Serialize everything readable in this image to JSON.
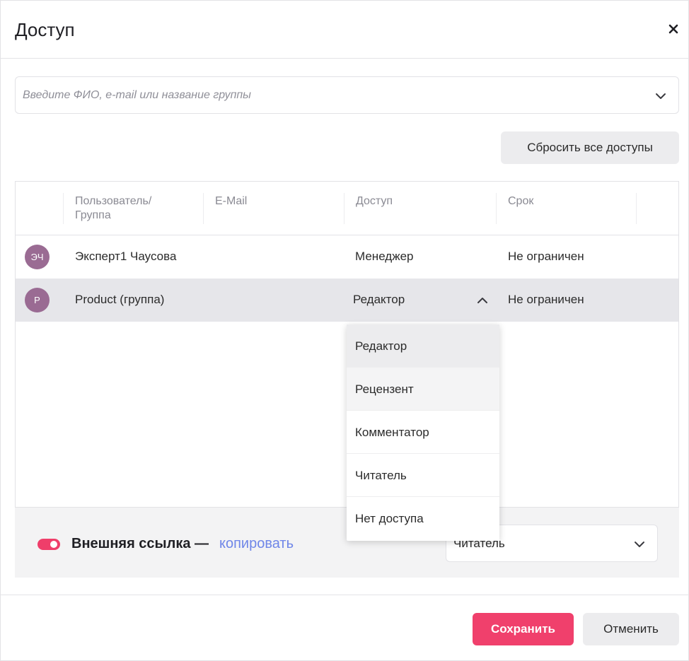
{
  "dialog": {
    "title": "Доступ",
    "close_icon": "close-icon"
  },
  "search": {
    "placeholder": "Введите ФИО, e-mail или название группы",
    "value": ""
  },
  "reset_button_label": "Сбросить все доступы",
  "table": {
    "columns": [
      "Пользователь/ Группа",
      "E-Mail",
      "Доступ",
      "Срок"
    ],
    "rows": [
      {
        "initials": "ЭЧ",
        "name": "Эксперт1 Чаусова",
        "email": "",
        "access": "Менеджер",
        "term": "Не ограничен"
      },
      {
        "initials": "P",
        "name": "Product (группа)",
        "email": "",
        "access": "Редактор",
        "term": "Не ограничен"
      }
    ]
  },
  "dropdown": {
    "options": [
      "Редактор",
      "Рецензент",
      "Комментатор",
      "Читатель",
      "Нет доступа"
    ],
    "selected": "Редактор",
    "hovered": "Рецензент"
  },
  "external_link": {
    "label": "Внешняя ссылка —",
    "copy_label": "копировать",
    "enabled": true,
    "role_value": "Читатель"
  },
  "footer": {
    "save_label": "Сохранить",
    "cancel_label": "Отменить"
  },
  "colors": {
    "accent": "#f0406c",
    "toggle": "#ef3e6a",
    "link": "#6f86e8",
    "avatar": "#9a6b93",
    "selected_row": "#e6e6ea"
  }
}
